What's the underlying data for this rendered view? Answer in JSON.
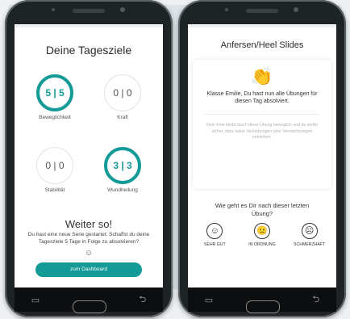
{
  "left_screen": {
    "title": "Deine Tagesziele",
    "goals": [
      {
        "value": "5 | 5",
        "label": "Beweglichkeit",
        "complete": true
      },
      {
        "value": "0 | 0",
        "label": "Kraft",
        "complete": false
      },
      {
        "value": "0 | 0",
        "label": "Stabilität",
        "complete": false
      },
      {
        "value": "3 | 3",
        "label": "Wundheilung",
        "complete": true
      }
    ],
    "cheer": "Weiter so!",
    "message": "Du hast eine neue Serie gestartet: Schaffst du deine Tagesziele 5 Tage in Folge zu absolvieren?",
    "smile": "☺",
    "cta_label": "zum Dashboard",
    "accent": "#149a97"
  },
  "right_screen": {
    "title": "Anfersen/Heel Slides",
    "clap_icon": "👏",
    "praise": "Klasse Emilie, Du hast nun alle Übungen für diesen Tag absolviert.",
    "note": "Dein Knie bleibt durch diese Übung beweglich und du stellst sicher, dass keine Verklebungen oder Verwachsungen entstehen.",
    "question": "Wie geht es Dir nach dieser letzten Übung?",
    "ratings": [
      {
        "face": "☺",
        "label": "SEHR GUT"
      },
      {
        "face": "😐",
        "label": "IN ORDNUNG"
      },
      {
        "face": "☹",
        "label": "SCHMERZHAFT"
      }
    ]
  },
  "nav": {
    "recent": "▭",
    "back": "⮌"
  }
}
